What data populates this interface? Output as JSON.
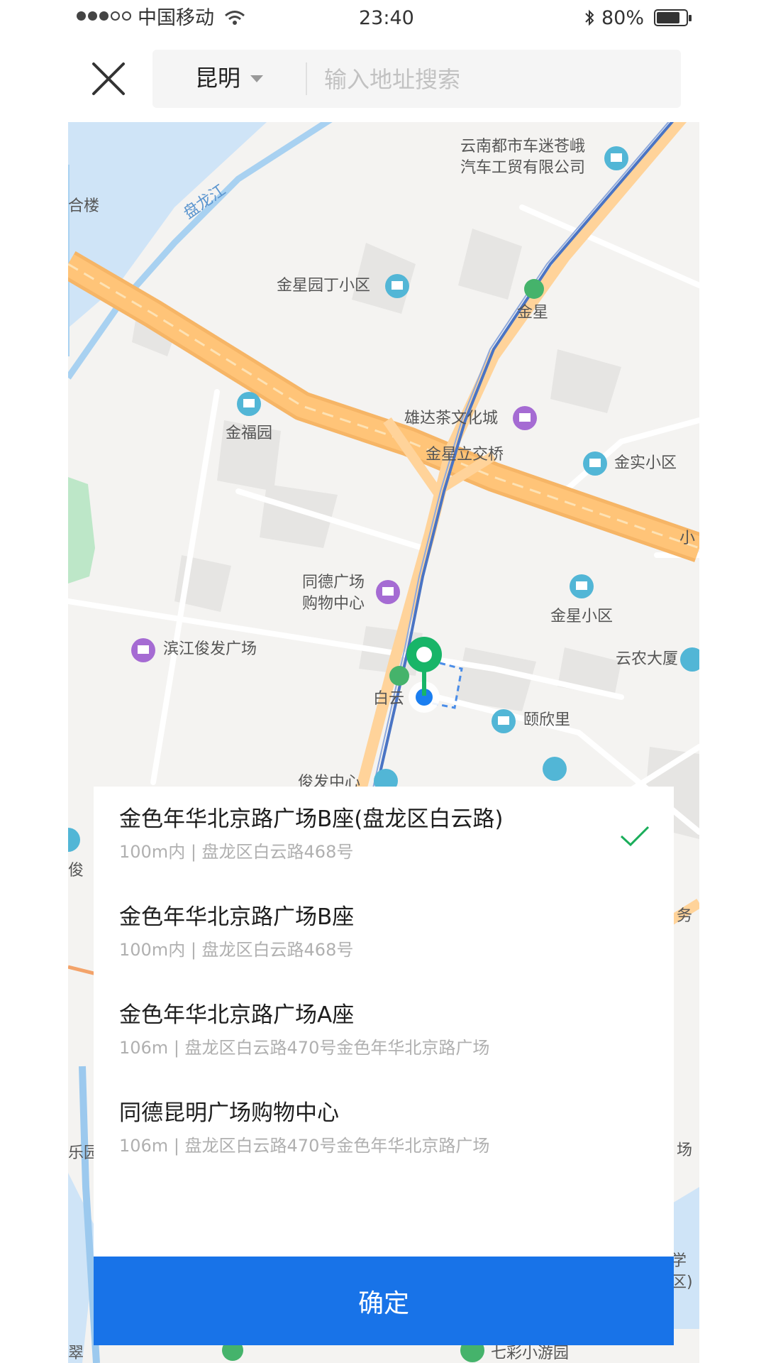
{
  "status_bar": {
    "carrier": "中国移动",
    "time": "23:40",
    "battery_percent": "80%",
    "battery_level": 0.8,
    "signal_icon": "signal-dots-icon",
    "wifi_icon": "wifi-icon",
    "bluetooth_icon": "bluetooth-icon"
  },
  "header": {
    "close_icon": "close-icon",
    "city": "昆明",
    "search_placeholder": "输入地址搜索"
  },
  "map": {
    "pois": {
      "p1": "云南都市车迷苍峨",
      "p1b": "汽车工贸有限公司",
      "p2": "合楼",
      "p3": "盘龙江",
      "p4": "金星园丁小区",
      "p5": "金星",
      "p6": "雄达茶文化城",
      "p7": "金福园",
      "p8": "金星立交桥",
      "p9": "金实小区",
      "p10": "小",
      "p11": "同德广场",
      "p11b": "购物中心",
      "p12": "金星小区",
      "p13": "滨江俊发广场",
      "p14": "云农大厦",
      "p15": "白云",
      "p16": "颐欣里",
      "p17": "俊发中心",
      "p18": "俊",
      "p19": "务",
      "p20": "乐园",
      "p21": "场",
      "p22": "学",
      "p23": "区)",
      "p24": "翠",
      "p25": "七彩小游园"
    },
    "colors": {
      "water": "#cfe4f7",
      "river_line": "#9cc9ee",
      "highway": "#ffc478",
      "highway_edge": "#f6b566",
      "metro": "#4a74c4",
      "park": "#bde7c8",
      "pin": "#18b568",
      "location": "#1a7ef0"
    }
  },
  "results": [
    {
      "title": "金色年华北京路广场B座(盘龙区白云路)",
      "subtitle": "100m内 | 盘龙区白云路468号",
      "selected": true
    },
    {
      "title": "金色年华北京路广场B座",
      "subtitle": "100m内 | 盘龙区白云路468号",
      "selected": false
    },
    {
      "title": "金色年华北京路广场A座",
      "subtitle": "106m | 盘龙区白云路470号金色年华北京路广场",
      "selected": false
    },
    {
      "title": "同德昆明广场购物中心",
      "subtitle": "106m | 盘龙区白云路470号金色年华北京路广场",
      "selected": false
    }
  ],
  "confirm_label": "确定",
  "accent_color": "#1873e8",
  "check_color": "#1aad5a"
}
